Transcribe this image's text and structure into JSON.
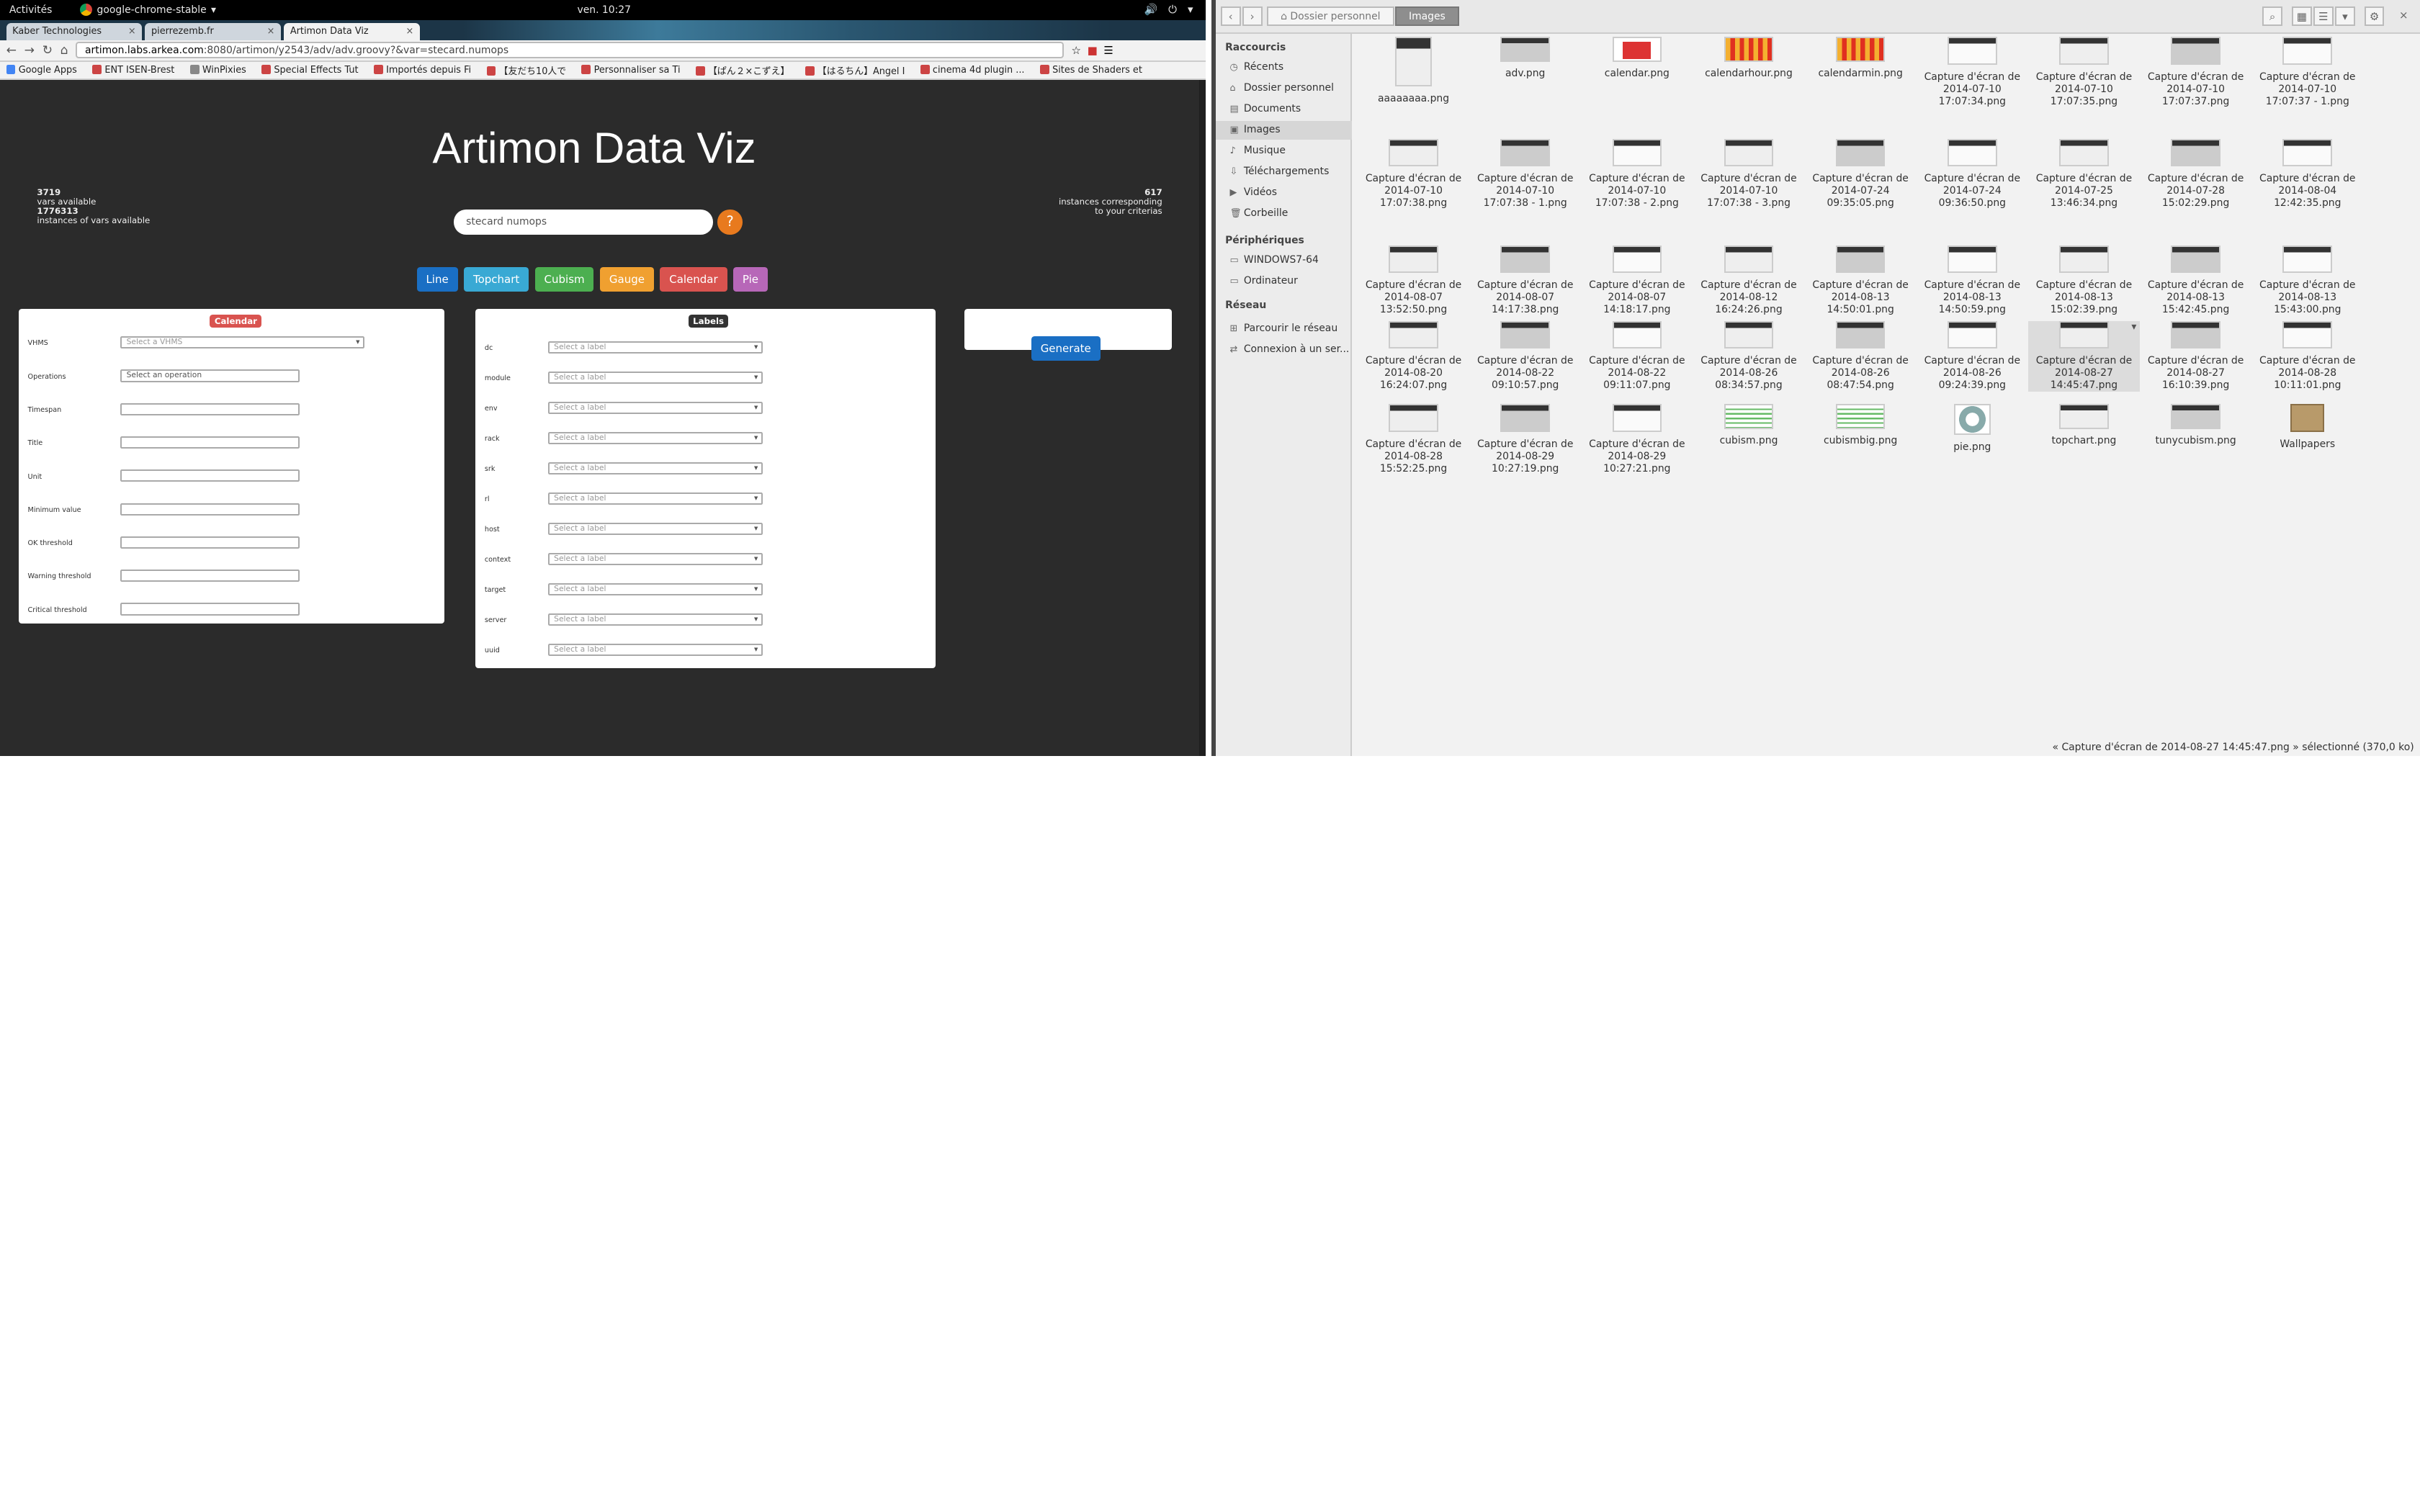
{
  "topbar": {
    "activities": "Activités",
    "app": "google-chrome-stable",
    "clock": "ven. 10:27"
  },
  "chrome": {
    "tabs": [
      "Kaber Technologies",
      "pierrezemb.fr",
      "Artimon Data Viz"
    ],
    "url_host": "artimon.labs.arkea.com",
    "url_rest": ":8080/artimon/y2543/adv/adv.groovy?&var=stecard.numops",
    "bookmarks": [
      "Google Apps",
      "ENT ISEN-Brest",
      "WinPixies",
      "Special Effects Tut",
      "Importés depuis Fi",
      "【友だち10人で",
      "Personnaliser sa Ti",
      "【ぱん２×こずえ】",
      "【はるちん】Angel I",
      "cinema 4d plugin ...",
      "Sites de Shaders et"
    ]
  },
  "page": {
    "title": "Artimon Data Viz",
    "vars_count": "3719",
    "vars_label": "vars available",
    "inst_count": "1776313",
    "inst_label": "instances of vars available",
    "match_count": "617",
    "match_label1": "instances corresponding",
    "match_label2": "to your criterias",
    "search_value": "stecard numops",
    "help_label": "?",
    "buttons": [
      {
        "label": "Line",
        "color": "#1a6fc4"
      },
      {
        "label": "Topchart",
        "color": "#39a9d4"
      },
      {
        "label": "Cubism",
        "color": "#4caf50"
      },
      {
        "label": "Gauge",
        "color": "#f0a030"
      },
      {
        "label": "Calendar",
        "color": "#d9534f"
      },
      {
        "label": "Pie",
        "color": "#b767b8"
      }
    ],
    "calendar_panel": {
      "badge": "Calendar",
      "fields": [
        {
          "label": "VHMS",
          "value": "Select a VHMS",
          "type": "select"
        },
        {
          "label": "Operations",
          "value": "Select an operation",
          "type": "input"
        },
        {
          "label": "Timespan",
          "value": "",
          "type": "input"
        },
        {
          "label": "Title",
          "value": "",
          "type": "input"
        },
        {
          "label": "Unit",
          "value": "",
          "type": "input"
        },
        {
          "label": "Minimum value",
          "value": "",
          "type": "input"
        },
        {
          "label": "OK threshold",
          "value": "",
          "type": "input"
        },
        {
          "label": "Warning threshold",
          "value": "",
          "type": "input"
        },
        {
          "label": "Critical threshold",
          "value": "",
          "type": "input"
        }
      ]
    },
    "labels_panel": {
      "badge": "Labels",
      "placeholder": "Select a label",
      "fields": [
        "dc",
        "module",
        "env",
        "rack",
        "srk",
        "rl",
        "host",
        "context",
        "target",
        "server",
        "uuid"
      ]
    },
    "generate_label": "Generate"
  },
  "filemanager": {
    "breadcrumbs": [
      "Dossier personnel",
      "Images"
    ],
    "sections": {
      "shortcuts": "Raccourcis",
      "devices": "Périphériques",
      "network": "Réseau"
    },
    "shortcuts": [
      "Récents",
      "Dossier personnel",
      "Documents",
      "Images",
      "Musique",
      "Téléchargements",
      "Vidéos",
      "Corbeille"
    ],
    "devices": [
      "WINDOWS7-64",
      "Ordinateur"
    ],
    "network": [
      "Parcourir le réseau",
      "Connexion à un ser..."
    ],
    "files": [
      [
        "aaaaaaaa.png"
      ],
      [
        "adv.png"
      ],
      [
        "calendar.png"
      ],
      [
        "calendarhour.png"
      ],
      [
        "calendarmin.png"
      ],
      [
        "Capture d'écran de",
        "2014-07-10",
        "17:07:34.png"
      ],
      [
        "Capture d'écran de",
        "2014-07-10",
        "17:07:35.png"
      ],
      [
        "Capture d'écran de",
        "2014-07-10",
        "17:07:37.png"
      ],
      [
        "Capture d'écran de",
        "2014-07-10",
        "17:07:37 - 1.png"
      ],
      [
        "Capture d'écran de",
        "2014-07-10",
        "17:07:38.png"
      ],
      [
        "Capture d'écran de",
        "2014-07-10",
        "17:07:38 - 1.png"
      ],
      [
        "Capture d'écran de",
        "2014-07-10",
        "17:07:38 - 2.png"
      ],
      [
        "Capture d'écran de",
        "2014-07-10",
        "17:07:38 - 3.png"
      ],
      [
        "Capture d'écran de",
        "2014-07-24",
        "09:35:05.png"
      ],
      [
        "Capture d'écran de",
        "2014-07-24",
        "09:36:50.png"
      ],
      [
        "Capture d'écran de",
        "2014-07-25",
        "13:46:34.png"
      ],
      [
        "Capture d'écran de",
        "2014-07-28",
        "15:02:29.png"
      ],
      [
        "Capture d'écran de",
        "2014-08-04",
        "12:42:35.png"
      ],
      [
        "Capture d'écran de",
        "2014-08-07",
        "13:52:50.png"
      ],
      [
        "Capture d'écran de",
        "2014-08-07",
        "14:17:38.png"
      ],
      [
        "Capture d'écran de",
        "2014-08-07",
        "14:18:17.png"
      ],
      [
        "Capture d'écran de",
        "2014-08-12",
        "16:24:26.png"
      ],
      [
        "Capture d'écran de",
        "2014-08-13",
        "14:50:01.png"
      ],
      [
        "Capture d'écran de",
        "2014-08-13",
        "14:50:59.png"
      ],
      [
        "Capture d'écran de",
        "2014-08-13",
        "15:02:39.png"
      ],
      [
        "Capture d'écran de",
        "2014-08-13",
        "15:42:45.png"
      ],
      [
        "Capture d'écran de",
        "2014-08-13",
        "15:43:00.png"
      ],
      [
        "Capture d'écran de",
        "2014-08-20",
        "16:24:07.png"
      ],
      [
        "Capture d'écran de",
        "2014-08-22",
        "09:10:57.png"
      ],
      [
        "Capture d'écran de",
        "2014-08-22",
        "09:11:07.png"
      ],
      [
        "Capture d'écran de",
        "2014-08-26",
        "08:34:57.png"
      ],
      [
        "Capture d'écran de",
        "2014-08-26",
        "08:47:54.png"
      ],
      [
        "Capture d'écran de",
        "2014-08-26",
        "09:24:39.png"
      ],
      [
        "Capture d'écran de",
        "2014-08-27",
        "14:45:47.png"
      ],
      [
        "Capture d'écran de",
        "2014-08-27",
        "16:10:39.png"
      ],
      [
        "Capture d'écran de",
        "2014-08-28",
        "10:11:01.png"
      ],
      [
        "Capture d'écran de",
        "2014-08-28",
        "15:52:25.png"
      ],
      [
        "Capture d'écran de",
        "2014-08-29",
        "10:27:19.png"
      ],
      [
        "Capture d'écran de",
        "2014-08-29",
        "10:27:21.png"
      ],
      [
        "cubism.png"
      ],
      [
        "cubismbig.png"
      ],
      [
        "pie.png"
      ],
      [
        "topchart.png"
      ],
      [
        "tunycubism.png"
      ],
      [
        "Wallpapers"
      ]
    ],
    "selected_file": "Capture d'écran de 2014-08-27 14:45:47.png",
    "status": "« Capture d'écran de 2014-08-27 14:45:47.png » sélectionné (370,0 ko)"
  }
}
